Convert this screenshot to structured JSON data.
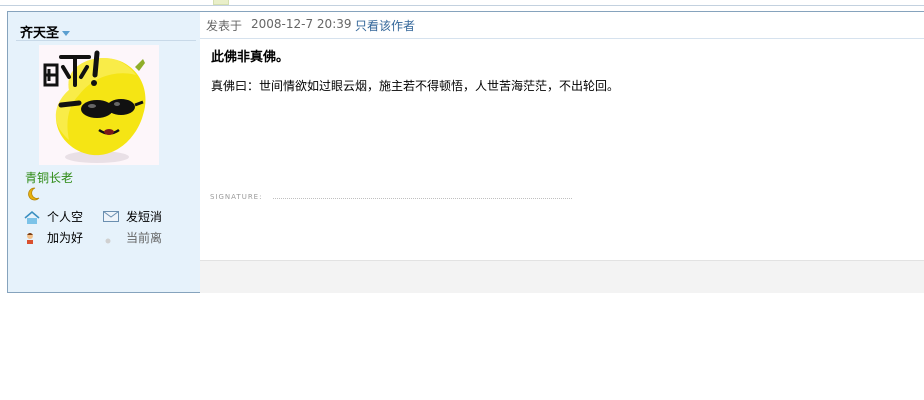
{
  "post": {
    "author": {
      "name": "齐天圣",
      "rank": "青铜长老",
      "avatar_text": "吓!",
      "actions": [
        {
          "label": "个人空",
          "icon": "home-icon"
        },
        {
          "label": "发短消",
          "icon": "envelope-icon"
        },
        {
          "label": "加为好",
          "icon": "add-friend-icon"
        },
        {
          "label": "当前离",
          "icon": "offline-status-icon"
        }
      ]
    },
    "info": {
      "posted_label": "发表于",
      "date": "2008-12-7 20:39",
      "only_author": "只看该作者"
    },
    "subject": "此佛非真佛。",
    "content": "真佛曰：世间情欲如过眼云烟，施主若不得顿悟，人世苦海茫茫，不出轮回。",
    "signature_label": "SIGNATURE:"
  },
  "colors": {
    "sidebar_bg": "#e6f2fb",
    "border": "#86a3bd",
    "rank_green": "#2e8b16",
    "link_blue": "#336699"
  }
}
